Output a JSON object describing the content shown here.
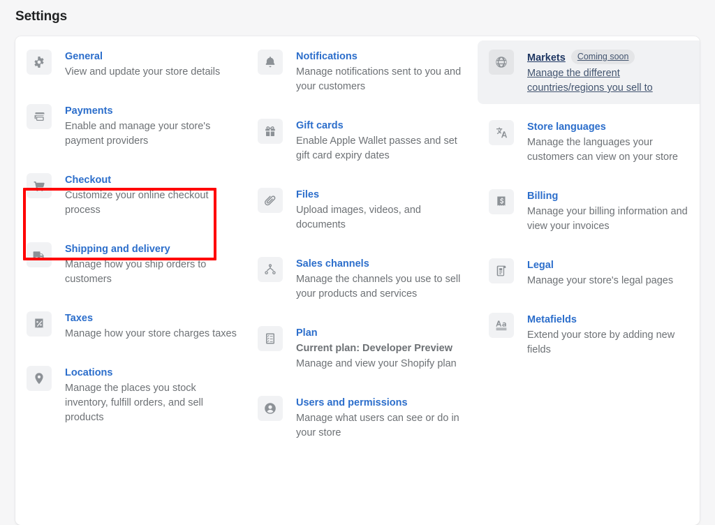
{
  "header": {
    "title": "Settings"
  },
  "colors": {
    "link": "#2c6ecb",
    "description": "#6d7175",
    "page_background": "#f6f6f7",
    "card_background": "#ffffff",
    "icon_tile": "#f1f2f4",
    "icon_glyph": "#8c9196",
    "hover_background": "#f1f2f4",
    "hover_text": "#1f3763",
    "badge_background": "#e4e5e7",
    "annotation_highlight": "#ff0000"
  },
  "columns": [
    {
      "items": [
        {
          "icon": "gear-icon",
          "title": "General",
          "description": "View and update your store details"
        },
        {
          "icon": "credit-cards-icon",
          "title": "Payments",
          "description": "Enable and manage your store's payment providers"
        },
        {
          "icon": "shopping-cart-icon",
          "title": "Checkout",
          "description": "Customize your online checkout process",
          "highlighted": true
        },
        {
          "icon": "delivery-truck-icon",
          "title": "Shipping and delivery",
          "description": "Manage how you ship orders to customers"
        },
        {
          "icon": "receipt-percent-icon",
          "title": "Taxes",
          "description": "Manage how your store charges taxes"
        },
        {
          "icon": "location-pin-icon",
          "title": "Locations",
          "description": "Manage the places you stock inventory, fulfill orders, and sell products"
        }
      ]
    },
    {
      "items": [
        {
          "icon": "bell-icon",
          "title": "Notifications",
          "description": "Manage notifications sent to you and your customers"
        },
        {
          "icon": "gift-card-icon",
          "title": "Gift cards",
          "description": "Enable Apple Wallet passes and set gift card expiry dates"
        },
        {
          "icon": "paperclip-icon",
          "title": "Files",
          "description": "Upload images, videos, and documents"
        },
        {
          "icon": "sales-channels-icon",
          "title": "Sales channels",
          "description": "Manage the channels you use to sell your products and services"
        },
        {
          "icon": "checklist-icon",
          "title": "Plan",
          "subtitle": "Current plan: Developer Preview",
          "description": "Manage and view your Shopify plan"
        },
        {
          "icon": "user-circle-icon",
          "title": "Users and permissions",
          "description": "Manage what users can see or do in your store"
        }
      ]
    },
    {
      "items": [
        {
          "icon": "globe-icon",
          "title": "Markets",
          "badge": "Coming soon",
          "description": "Manage the different countries/regions you sell to",
          "hovered": true
        },
        {
          "icon": "translate-icon",
          "title": "Store languages",
          "description": "Manage the languages your customers can view on your store"
        },
        {
          "icon": "billing-receipt-icon",
          "title": "Billing",
          "description": "Manage your billing information and view your invoices"
        },
        {
          "icon": "legal-scroll-icon",
          "title": "Legal",
          "description": "Manage your store's legal pages"
        },
        {
          "icon": "metafields-text-icon",
          "title": "Metafields",
          "description": "Extend your store by adding new fields"
        }
      ]
    }
  ]
}
